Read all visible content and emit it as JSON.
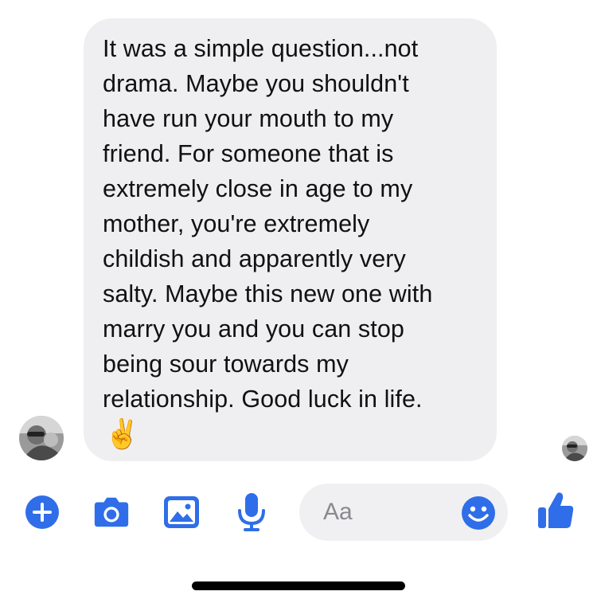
{
  "conversation": {
    "message": {
      "text": "It was a simple question...not\ndrama. Maybe you shouldn't\nhave run your mouth to my\nfriend. For someone that is\nextremely close in age to my\nmother, you're extremely\nchildish and apparently very\nsalty. Maybe this new one with\nmarry you and you can stop\nbeing sour towards my\nrelationship. Good luck in life.",
      "emoji": "✌️"
    }
  },
  "composer": {
    "placeholder": "Aa"
  },
  "toolbar": {
    "icons": [
      "plus-icon",
      "camera-icon",
      "photo-icon",
      "microphone-icon",
      "emoji-icon",
      "thumbs-up-icon"
    ]
  },
  "colors": {
    "accent": "#2f6ee8",
    "bubble": "#efeff1",
    "composer": "#f0f0f2"
  }
}
